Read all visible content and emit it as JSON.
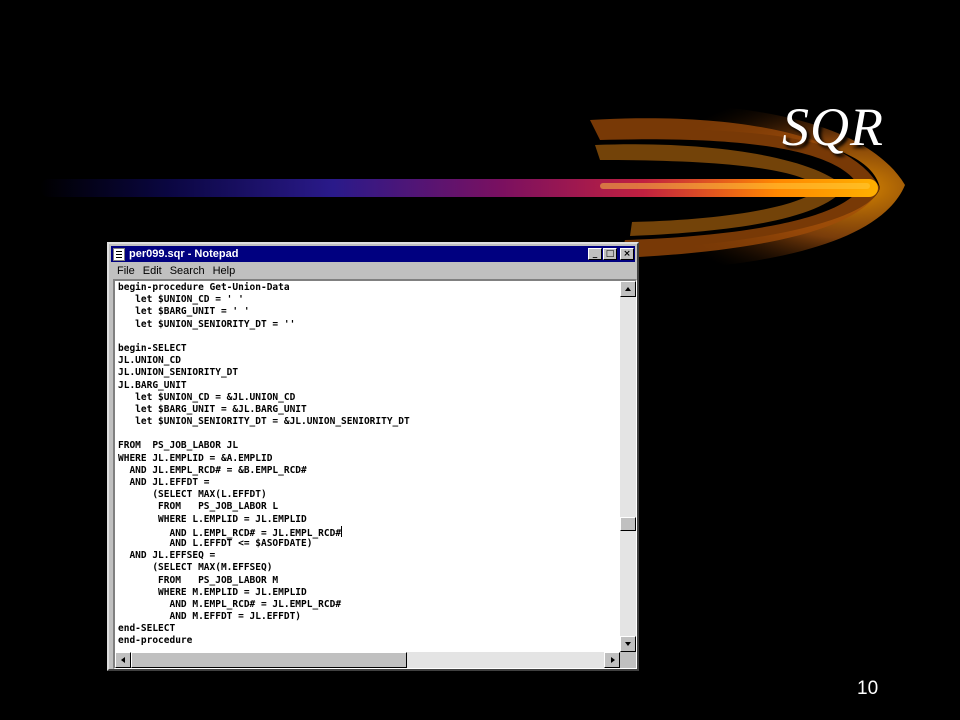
{
  "slide": {
    "title": "SQR",
    "page_number": "10"
  },
  "window": {
    "title": "per099.sqr - Notepad",
    "controls": {
      "minimize": "_",
      "maximize": "□",
      "close": "×"
    },
    "menu": [
      "File",
      "Edit",
      "Search",
      "Help"
    ]
  },
  "editor": {
    "lines": [
      "begin-procedure Get-Union-Data",
      "   let $UNION_CD = ' '",
      "   let $BARG_UNIT = ' '",
      "   let $UNION_SENIORITY_DT = ''",
      "",
      "begin-SELECT",
      "JL.UNION_CD",
      "JL.UNION_SENIORITY_DT",
      "JL.BARG_UNIT",
      "   let $UNION_CD = &JL.UNION_CD",
      "   let $BARG_UNIT = &JL.BARG_UNIT",
      "   let $UNION_SENIORITY_DT = &JL.UNION_SENIORITY_DT",
      "",
      "FROM  PS_JOB_LABOR JL",
      "WHERE JL.EMPLID = &A.EMPLID",
      "  AND JL.EMPL_RCD# = &B.EMPL_RCD#",
      "  AND JL.EFFDT =",
      "      (SELECT MAX(L.EFFDT)",
      "       FROM   PS_JOB_LABOR L",
      "       WHERE L.EMPLID = JL.EMPLID",
      "         AND L.EMPL_RCD# = JL.EMPL_RCD#",
      "         AND L.EFFDT <= $ASOFDATE)",
      "  AND JL.EFFSEQ =",
      "      (SELECT MAX(M.EFFSEQ)",
      "       FROM   PS_JOB_LABOR M",
      "       WHERE M.EMPLID = JL.EMPLID",
      "         AND M.EMPL_RCD# = JL.EMPL_RCD#",
      "         AND M.EFFDT = JL.EFFDT)",
      "end-SELECT",
      "end-procedure"
    ]
  },
  "colors": {
    "background": "#000000",
    "titlebar": "#000080",
    "window_chrome": "#c0c0c0",
    "swoosh_hot": "#ff9900",
    "swoosh_cool": "#1a0b6a"
  }
}
